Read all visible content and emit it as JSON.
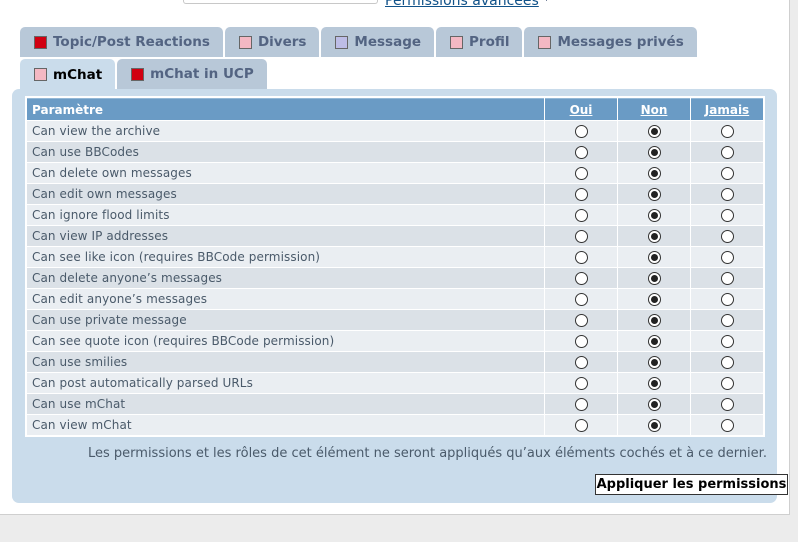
{
  "header": {
    "advanced_link": "Permissions avancées",
    "star": "*"
  },
  "colors": {
    "red_square": "#d10011",
    "pink_square": "#f4b8c3",
    "lavender_square": "#bdbde6"
  },
  "tabs_row1": [
    {
      "label": "Topic/Post Reactions",
      "color": "#d10011"
    },
    {
      "label": "Divers",
      "color": "#f4b8c3"
    },
    {
      "label": "Message",
      "color": "#bdbde6"
    },
    {
      "label": "Profil",
      "color": "#f4b8c3"
    },
    {
      "label": "Messages privés",
      "color": "#f4b8c3"
    }
  ],
  "tabs_row2": [
    {
      "label": "mChat",
      "color": "#f4b8c3",
      "active": true
    },
    {
      "label": "mChat in UCP",
      "color": "#d10011"
    }
  ],
  "table": {
    "col_param": "Paramètre",
    "col_yes": "Oui",
    "col_no": "Non",
    "col_never": "Jamais",
    "rows": [
      {
        "label": "Can view the archive",
        "selected": "Non"
      },
      {
        "label": "Can use BBCodes",
        "selected": "Non"
      },
      {
        "label": "Can delete own messages",
        "selected": "Non"
      },
      {
        "label": "Can edit own messages",
        "selected": "Non"
      },
      {
        "label": "Can ignore flood limits",
        "selected": "Non"
      },
      {
        "label": "Can view IP addresses",
        "selected": "Non"
      },
      {
        "label": "Can see like icon (requires BBCode permission)",
        "selected": "Non"
      },
      {
        "label": "Can delete anyone’s messages",
        "selected": "Non"
      },
      {
        "label": "Can edit anyone’s messages",
        "selected": "Non"
      },
      {
        "label": "Can use private message",
        "selected": "Non"
      },
      {
        "label": "Can see quote icon (requires BBCode permission)",
        "selected": "Non"
      },
      {
        "label": "Can use smilies",
        "selected": "Non"
      },
      {
        "label": "Can post automatically parsed URLs",
        "selected": "Non"
      },
      {
        "label": "Can use mChat",
        "selected": "Non"
      },
      {
        "label": "Can view mChat",
        "selected": "Non"
      }
    ]
  },
  "note": "Les permissions et les rôles de cet élément ne seront appliqués qu’aux éléments cochés et à ce dernier.",
  "apply_button": "Appliquer les permissions"
}
